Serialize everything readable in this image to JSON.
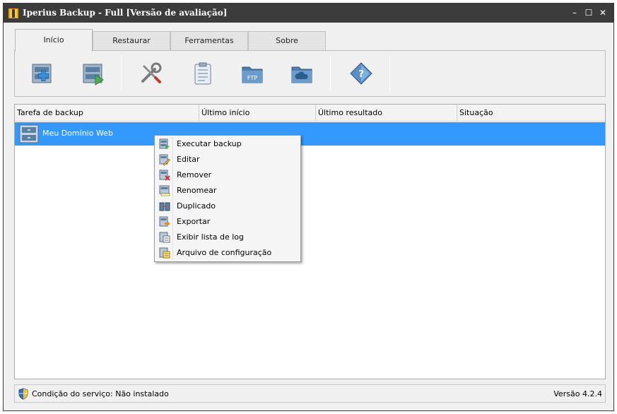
{
  "window": {
    "title": "Iperius Backup - Full  [Versão de avaliação]",
    "controls": {
      "minimize": "–",
      "maximize": "☐",
      "close": "✕"
    }
  },
  "tabs": [
    {
      "label": "Início",
      "active": true
    },
    {
      "label": "Restaurar",
      "active": false
    },
    {
      "label": "Ferramentas",
      "active": false
    },
    {
      "label": "Sobre",
      "active": false
    }
  ],
  "toolbar": {
    "buttons": [
      {
        "icon": "new-backup-icon"
      },
      {
        "icon": "run-backup-icon"
      },
      {
        "icon": "tools-icon"
      },
      {
        "icon": "clipboard-list-icon"
      },
      {
        "icon": "ftp-folder-icon"
      },
      {
        "icon": "cloud-folder-icon"
      },
      {
        "icon": "help-book-icon"
      }
    ]
  },
  "table": {
    "columns": [
      "Tarefa de backup",
      "Último início",
      "Último resultado",
      "Situação"
    ],
    "rows": [
      {
        "name": "Meu Domínio Web",
        "last_start": "",
        "last_result": "",
        "status": ""
      }
    ]
  },
  "context_menu": {
    "items": [
      {
        "label": "Executar backup",
        "icon": "execute-icon"
      },
      {
        "label": "Editar",
        "icon": "edit-icon"
      },
      {
        "label": "Remover",
        "icon": "remove-icon"
      },
      {
        "label": "Renomear",
        "icon": "rename-icon"
      },
      {
        "label": "Duplicado",
        "icon": "duplicate-icon"
      },
      {
        "label": "Exportar",
        "icon": "export-icon"
      },
      {
        "label": "Exibir lista de log",
        "icon": "log-list-icon"
      },
      {
        "label": "Arquivo de configuração",
        "icon": "config-file-icon"
      }
    ]
  },
  "statusbar": {
    "service_status": "Condição do serviço: Não instalado",
    "version": "Versão 4.2.4"
  },
  "colors": {
    "titlebar": "#3c3c3c",
    "selection": "#3399ff",
    "window_bg": "#f0f0f0"
  }
}
